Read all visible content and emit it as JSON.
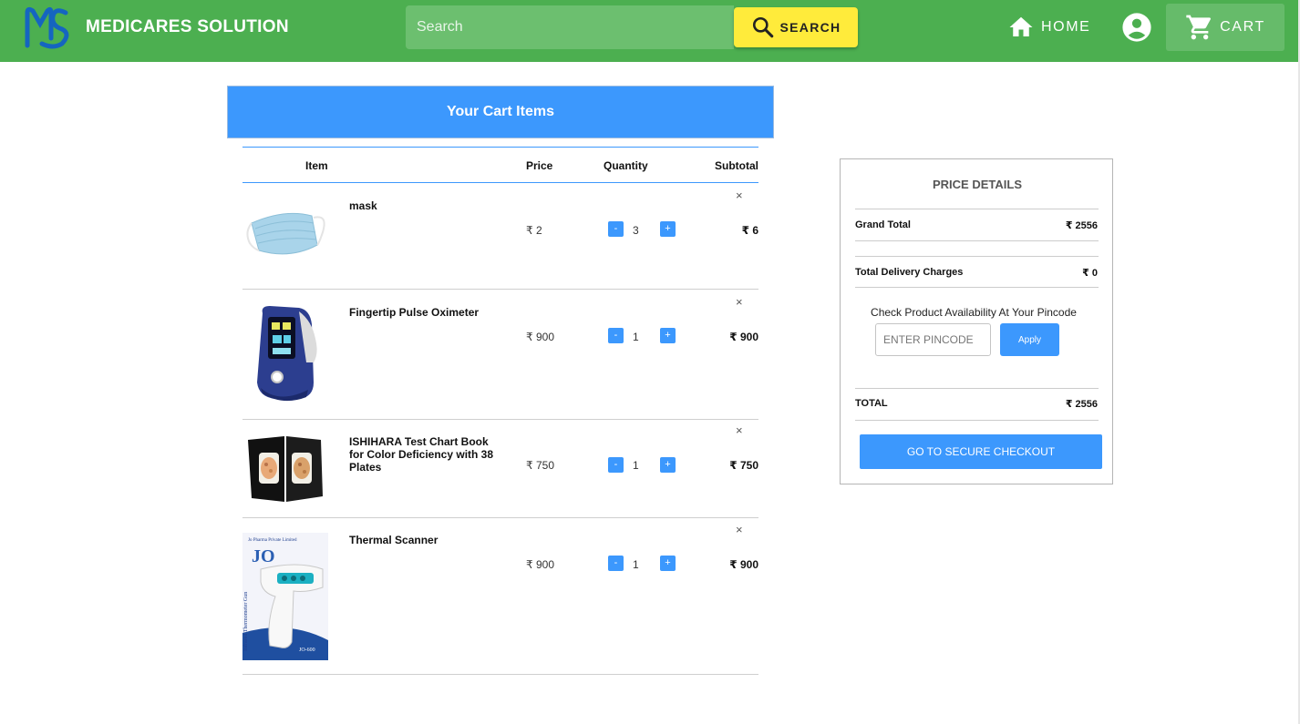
{
  "header": {
    "brand": "MEDICARES SOLUTION",
    "search_placeholder": "Search",
    "search_label": "SEARCH",
    "home_label": "HOME",
    "cart_label": "CART"
  },
  "cart": {
    "title": "Your Cart Items",
    "columns": {
      "item": "Item",
      "price": "Price",
      "quantity": "Quantity",
      "subtotal": "Subtotal"
    },
    "minus": "-",
    "plus": "+",
    "remove": "×",
    "items": [
      {
        "name": "mask",
        "price": "₹ 2",
        "qty": "3",
        "subtotal": "₹ 6"
      },
      {
        "name": "Fingertip Pulse Oximeter",
        "price": "₹ 900",
        "qty": "1",
        "subtotal": "₹ 900"
      },
      {
        "name": "ISHIHARA Test Chart Book for Color Deficiency with 38 Plates",
        "price": "₹ 750",
        "qty": "1",
        "subtotal": "₹ 750"
      },
      {
        "name": "Thermal Scanner",
        "price": "₹ 900",
        "qty": "1",
        "subtotal": "₹ 900"
      }
    ]
  },
  "price_details": {
    "title": "PRICE DETAILS",
    "grand_total_label": "Grand Total",
    "grand_total_value": "₹ 2556",
    "delivery_label": "Total Delivery Charges",
    "delivery_value": "₹ 0",
    "check_text": "Check Product Availability At Your Pincode",
    "pincode_placeholder": "ENTER PINCODE",
    "apply_label": "Apply",
    "total_label": "TOTAL",
    "total_value": "₹ 2556",
    "checkout_label": "GO TO SECURE CHECKOUT"
  },
  "product_images": {
    "scanner_brand": "Jo Pharma Private Limited",
    "scanner_logo": "JO",
    "scanner_side_text": "Infrared Thermometer Gun",
    "scanner_model": "JO-600"
  },
  "colors": {
    "header_green": "#4caf50",
    "search_yellow": "#ffeb3b",
    "accent_blue": "#3c98fd"
  }
}
